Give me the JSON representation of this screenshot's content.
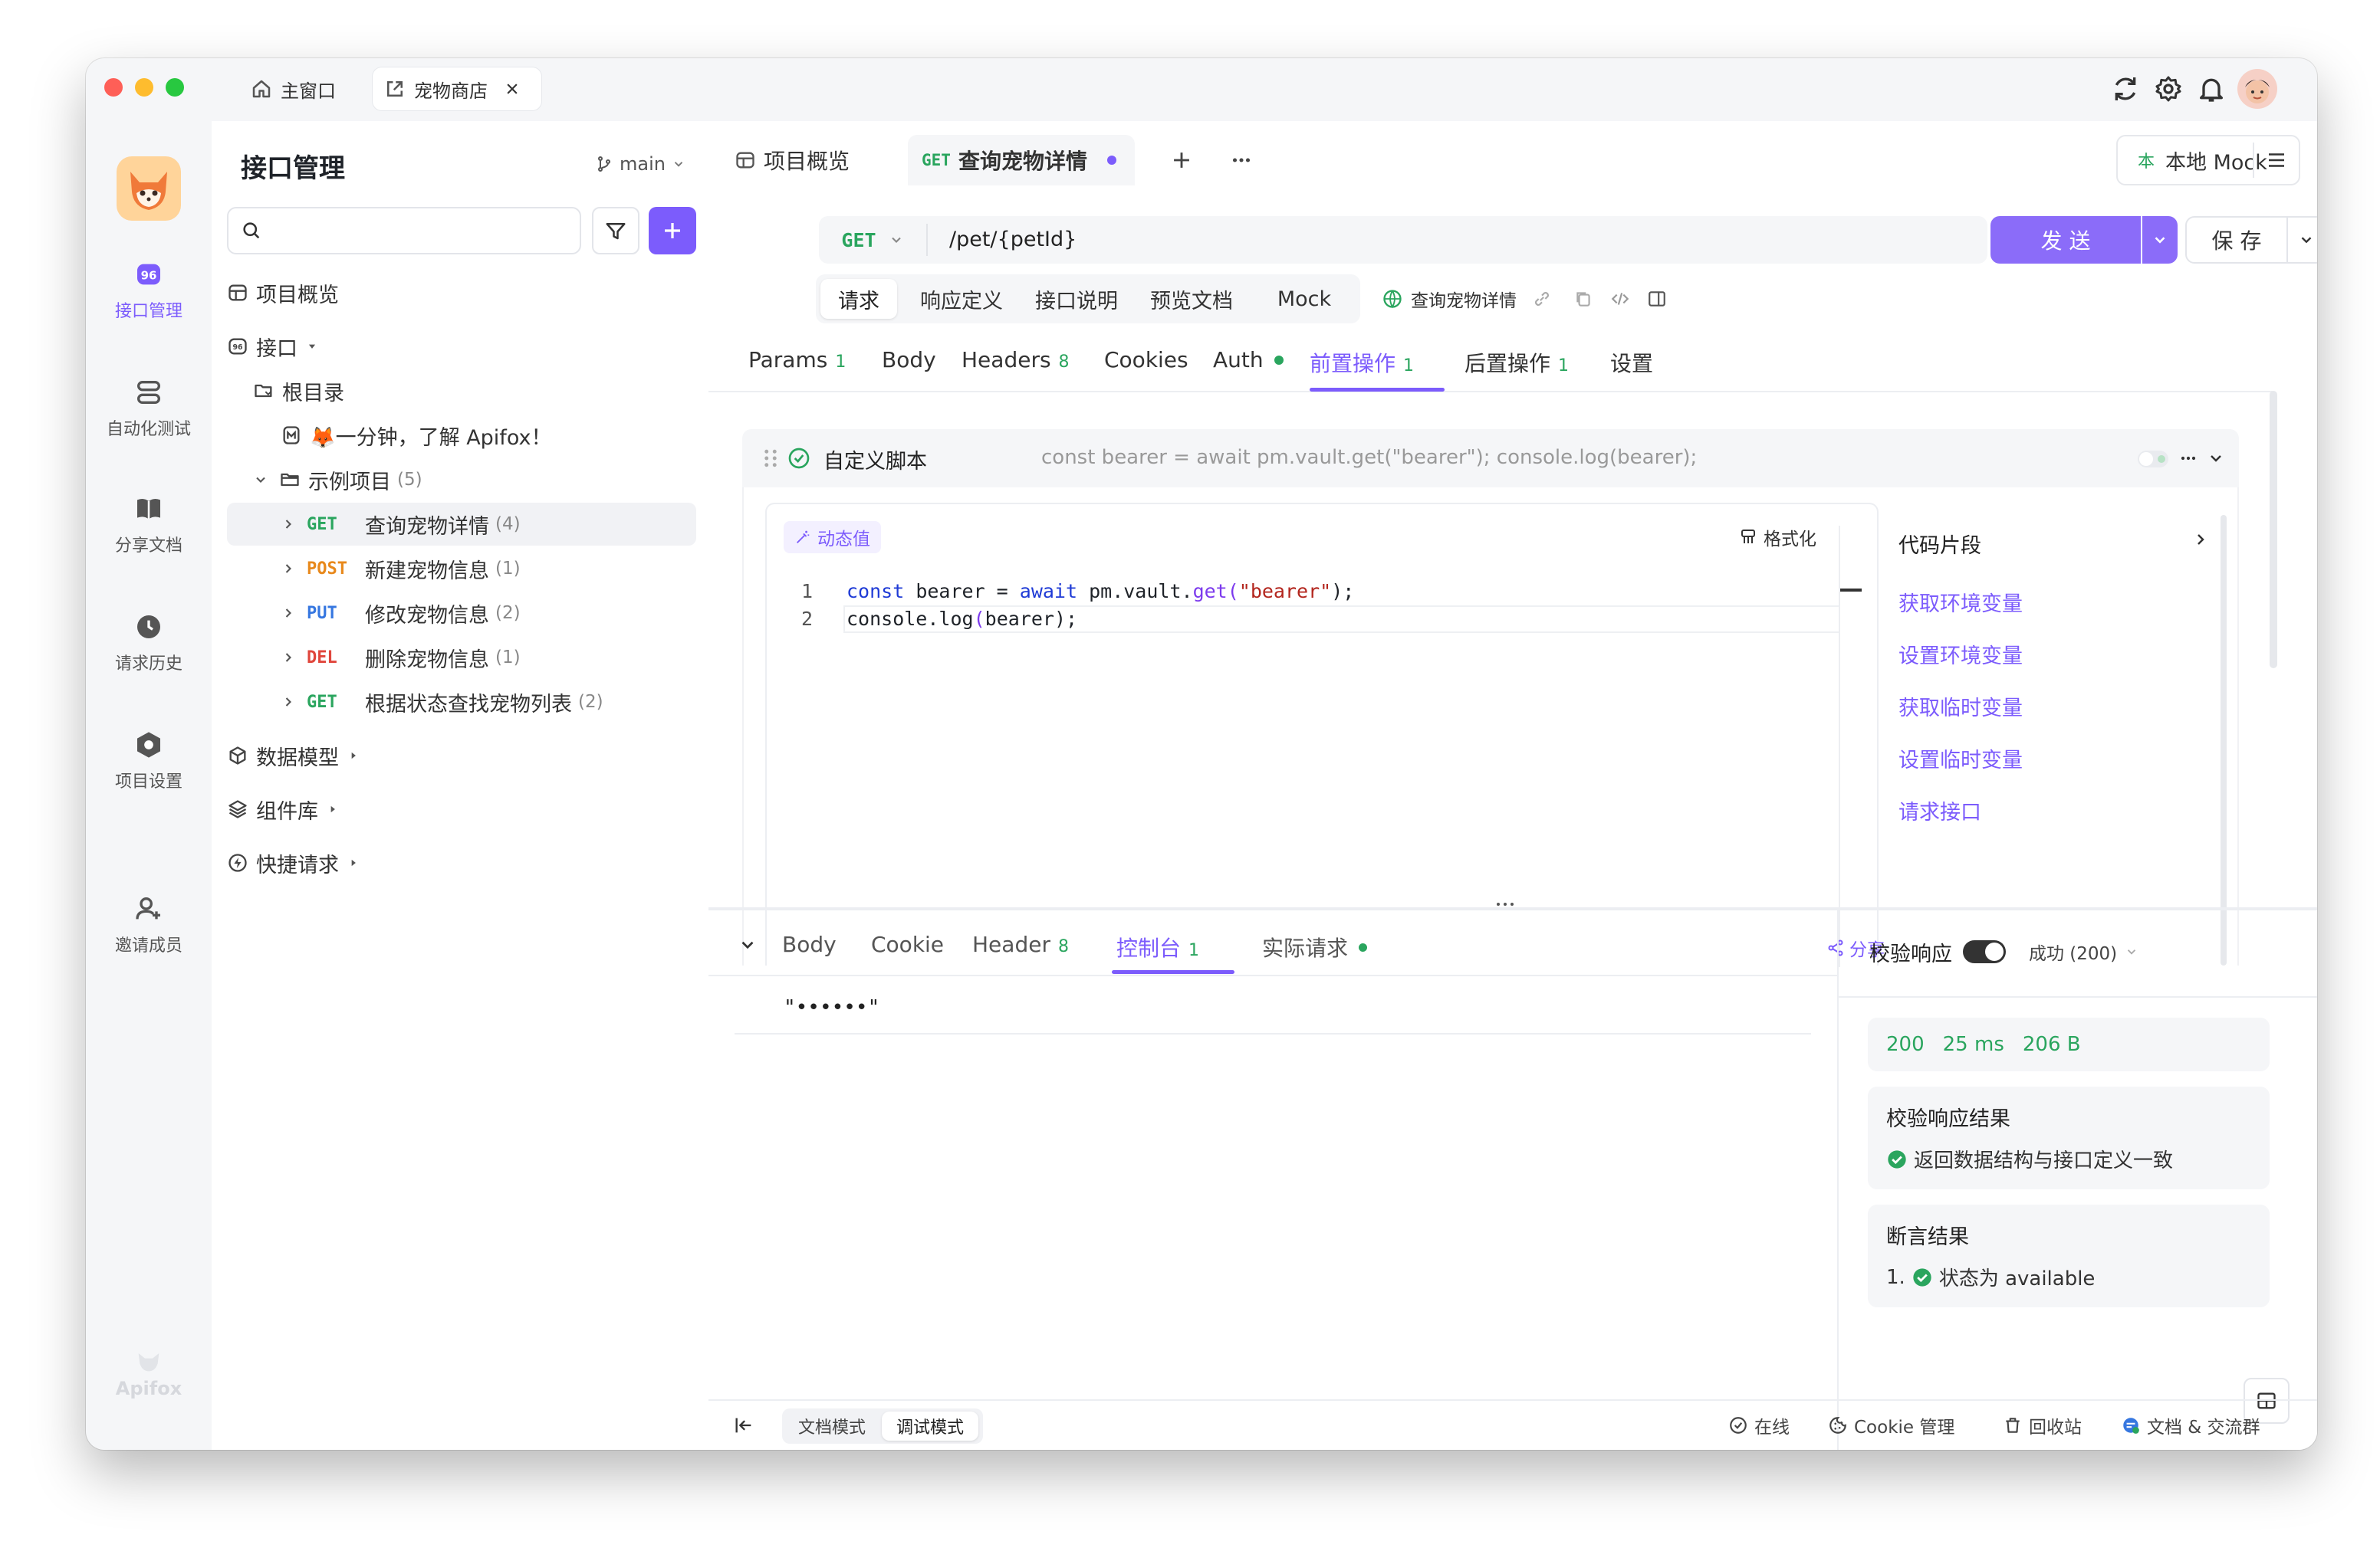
{
  "window_tabs": [
    {
      "label": "主窗口"
    },
    {
      "label": "宠物商店"
    }
  ],
  "rail": {
    "items": [
      {
        "label": "接口管理"
      },
      {
        "label": "自动化测试"
      },
      {
        "label": "分享文档"
      },
      {
        "label": "请求历史"
      },
      {
        "label": "项目设置"
      },
      {
        "label": "邀请成员"
      }
    ],
    "brand": "Apifox"
  },
  "sidebar": {
    "title": "接口管理",
    "branch": "main",
    "search_placeholder": "",
    "overview": "项目概览",
    "api_label": "接口",
    "root": "根目录",
    "intro_doc": "🦊一分钟，了解 Apifox！",
    "folder": {
      "label": "示例项目",
      "count": "(5)"
    },
    "endpoints": [
      {
        "method": "GET",
        "label": "查询宠物详情",
        "count": "(4)"
      },
      {
        "method": "POST",
        "label": "新建宠物信息",
        "count": "(1)"
      },
      {
        "method": "PUT",
        "label": "修改宠物信息",
        "count": "(2)"
      },
      {
        "method": "DEL",
        "label": "删除宠物信息",
        "count": "(1)"
      },
      {
        "method": "GET",
        "label": "根据状态查找宠物列表",
        "count": "(2)"
      }
    ],
    "data_models": "数据模型",
    "components": "组件库",
    "quick_requests": "快捷请求"
  },
  "tabs": {
    "overview": "项目概览",
    "active_method": "GET",
    "active_label": "查询宠物详情"
  },
  "env": {
    "badge": "本",
    "label": "本地 Mock"
  },
  "request": {
    "method": "GET",
    "url": "/pet/{petId}",
    "send": "发 送",
    "save": "保 存"
  },
  "mode_tabs": [
    {
      "label": "请求"
    },
    {
      "label": "响应定义"
    },
    {
      "label": "接口说明"
    },
    {
      "label": "预览文档"
    },
    {
      "label": "Mock"
    }
  ],
  "api_name": "查询宠物详情",
  "param_tabs": [
    {
      "label": "Params",
      "badge": "1"
    },
    {
      "label": "Body",
      "badge": ""
    },
    {
      "label": "Headers",
      "badge": "8"
    },
    {
      "label": "Cookies",
      "badge": ""
    },
    {
      "label": "Auth",
      "badge": ""
    },
    {
      "label": "前置操作",
      "badge": "1"
    },
    {
      "label": "后置操作",
      "badge": "1"
    },
    {
      "label": "设置",
      "badge": ""
    }
  ],
  "script": {
    "title": "自定义脚本",
    "preview": "const bearer = await pm.vault.get(\"bearer\"); console.log(bearer);",
    "dynamic_value": "动态值",
    "format": "格式化",
    "lines": [
      {
        "no": "1",
        "k1": "const",
        "t1": " bearer = ",
        "k2": "await",
        "t2": " pm.vault.",
        "f": "get",
        "p1": "(",
        "s": "\"bearer\"",
        "p2": ");"
      },
      {
        "no": "2",
        "t1": "console.",
        "f": "log",
        "p1": "(",
        "t2": "bearer",
        "p2": ");"
      }
    ]
  },
  "snippets": {
    "title": "代码片段",
    "items": [
      "获取环境变量",
      "设置环境变量",
      "获取临时变量",
      "设置临时变量",
      "请求接口"
    ]
  },
  "response_tabs": [
    {
      "label": "Body",
      "badge": ""
    },
    {
      "label": "Cookie",
      "badge": ""
    },
    {
      "label": "Header",
      "badge": "8"
    },
    {
      "label": "控制台",
      "badge": "1"
    },
    {
      "label": "实际请求",
      "badge": ""
    }
  ],
  "share": "分享",
  "console_output": "\"••••••\"",
  "validate": {
    "label": "校验响应",
    "status": "成功 (200)",
    "stats": {
      "code": "200",
      "time": "25 ms",
      "size": "206 B"
    },
    "result_title": "校验响应结果",
    "result_text": "返回数据结构与接口定义一致",
    "assert_title": "断言结果",
    "assert_index": "1.",
    "assert_text": "状态为 available"
  },
  "footer": {
    "doc_mode": "文档模式",
    "debug_mode": "调试模式",
    "online": "在线",
    "cookie": "Cookie 管理",
    "trash": "回收站",
    "community": "文档 & 交流群"
  },
  "colors": {
    "accent": "#7c5cfc",
    "get": "#2aa55e",
    "post": "#e8891c",
    "put": "#3677e0",
    "del": "#e0463c"
  }
}
